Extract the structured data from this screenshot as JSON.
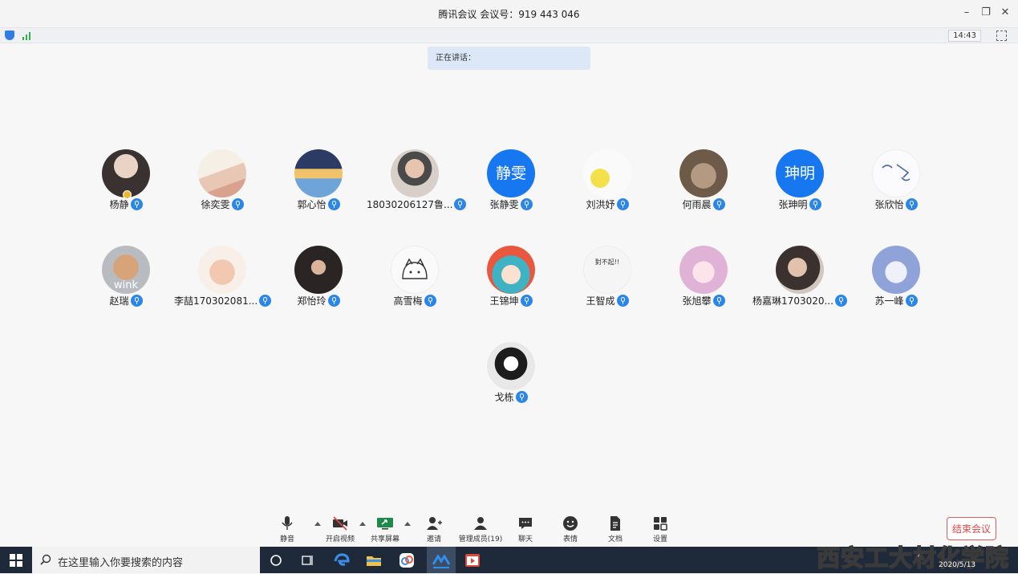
{
  "window": {
    "title": "腾讯会议 会议号：919 443 046"
  },
  "statusbar": {
    "time": "14:43"
  },
  "speaking": {
    "label": "正在讲话："
  },
  "participants": [
    {
      "name": "杨静",
      "avatar_text": ""
    },
    {
      "name": "徐奕雯",
      "avatar_text": ""
    },
    {
      "name": "郭心怡",
      "avatar_text": ""
    },
    {
      "name": "18030206127鲁...",
      "avatar_text": ""
    },
    {
      "name": "张静雯",
      "avatar_text": "静雯"
    },
    {
      "name": "刘洪妤",
      "avatar_text": ""
    },
    {
      "name": "何雨晨",
      "avatar_text": ""
    },
    {
      "name": "张珅明",
      "avatar_text": "珅明"
    },
    {
      "name": "张欣怡",
      "avatar_text": ""
    },
    {
      "name": "赵瑞",
      "avatar_text": "wink"
    },
    {
      "name": "李喆170302081...",
      "avatar_text": ""
    },
    {
      "name": "郑怡玲",
      "avatar_text": ""
    },
    {
      "name": "高雪梅",
      "avatar_text": ""
    },
    {
      "name": "王锦坤",
      "avatar_text": ""
    },
    {
      "name": "王智成",
      "avatar_text": "對不起!!"
    },
    {
      "name": "张旭攀",
      "avatar_text": ""
    },
    {
      "name": "杨嘉琳1703020...",
      "avatar_text": ""
    },
    {
      "name": "苏一峰",
      "avatar_text": ""
    },
    {
      "name": "戈栋",
      "avatar_text": ""
    }
  ],
  "toolbar": {
    "mute": "静音",
    "video": "开启视频",
    "share": "共享屏幕",
    "invite": "邀请",
    "members": "管理成员(19)",
    "chat": "聊天",
    "emoji": "表情",
    "docs": "文档",
    "settings": "设置",
    "end": "结束会议"
  },
  "taskbar": {
    "search_placeholder": "在这里输入你要搜索的内容",
    "date": "2020/5/13"
  },
  "watermark": {
    "text": "西安工大材化学院"
  },
  "colors": {
    "accent": "#1677f0",
    "mic": "#2b86ea",
    "end": "#e04646"
  }
}
